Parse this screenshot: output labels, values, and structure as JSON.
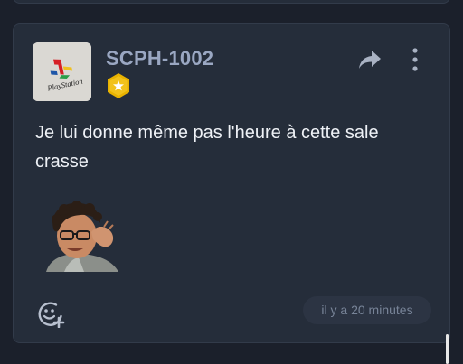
{
  "post": {
    "author": {
      "name": "SCPH-1002",
      "avatar_icon": "playstation-logo-icon",
      "avatar_text": "PlayStation",
      "badge_icon": "star-hexagon-badge-icon",
      "badge_color": "#e8b200"
    },
    "message": "Je lui donne même pas l'heure à cette sale crasse",
    "sticker_icon": "meme-sticker-man-adjusting-glasses",
    "actions": {
      "share_icon": "share-arrow-icon",
      "more_icon": "more-vertical-icon",
      "react_icon": "add-reaction-icon"
    },
    "timestamp": "il y a 20 minutes"
  },
  "colors": {
    "background": "#1b202b",
    "card": "#252d3a",
    "username": "#9aa7c2",
    "text": "#eef1f6"
  }
}
